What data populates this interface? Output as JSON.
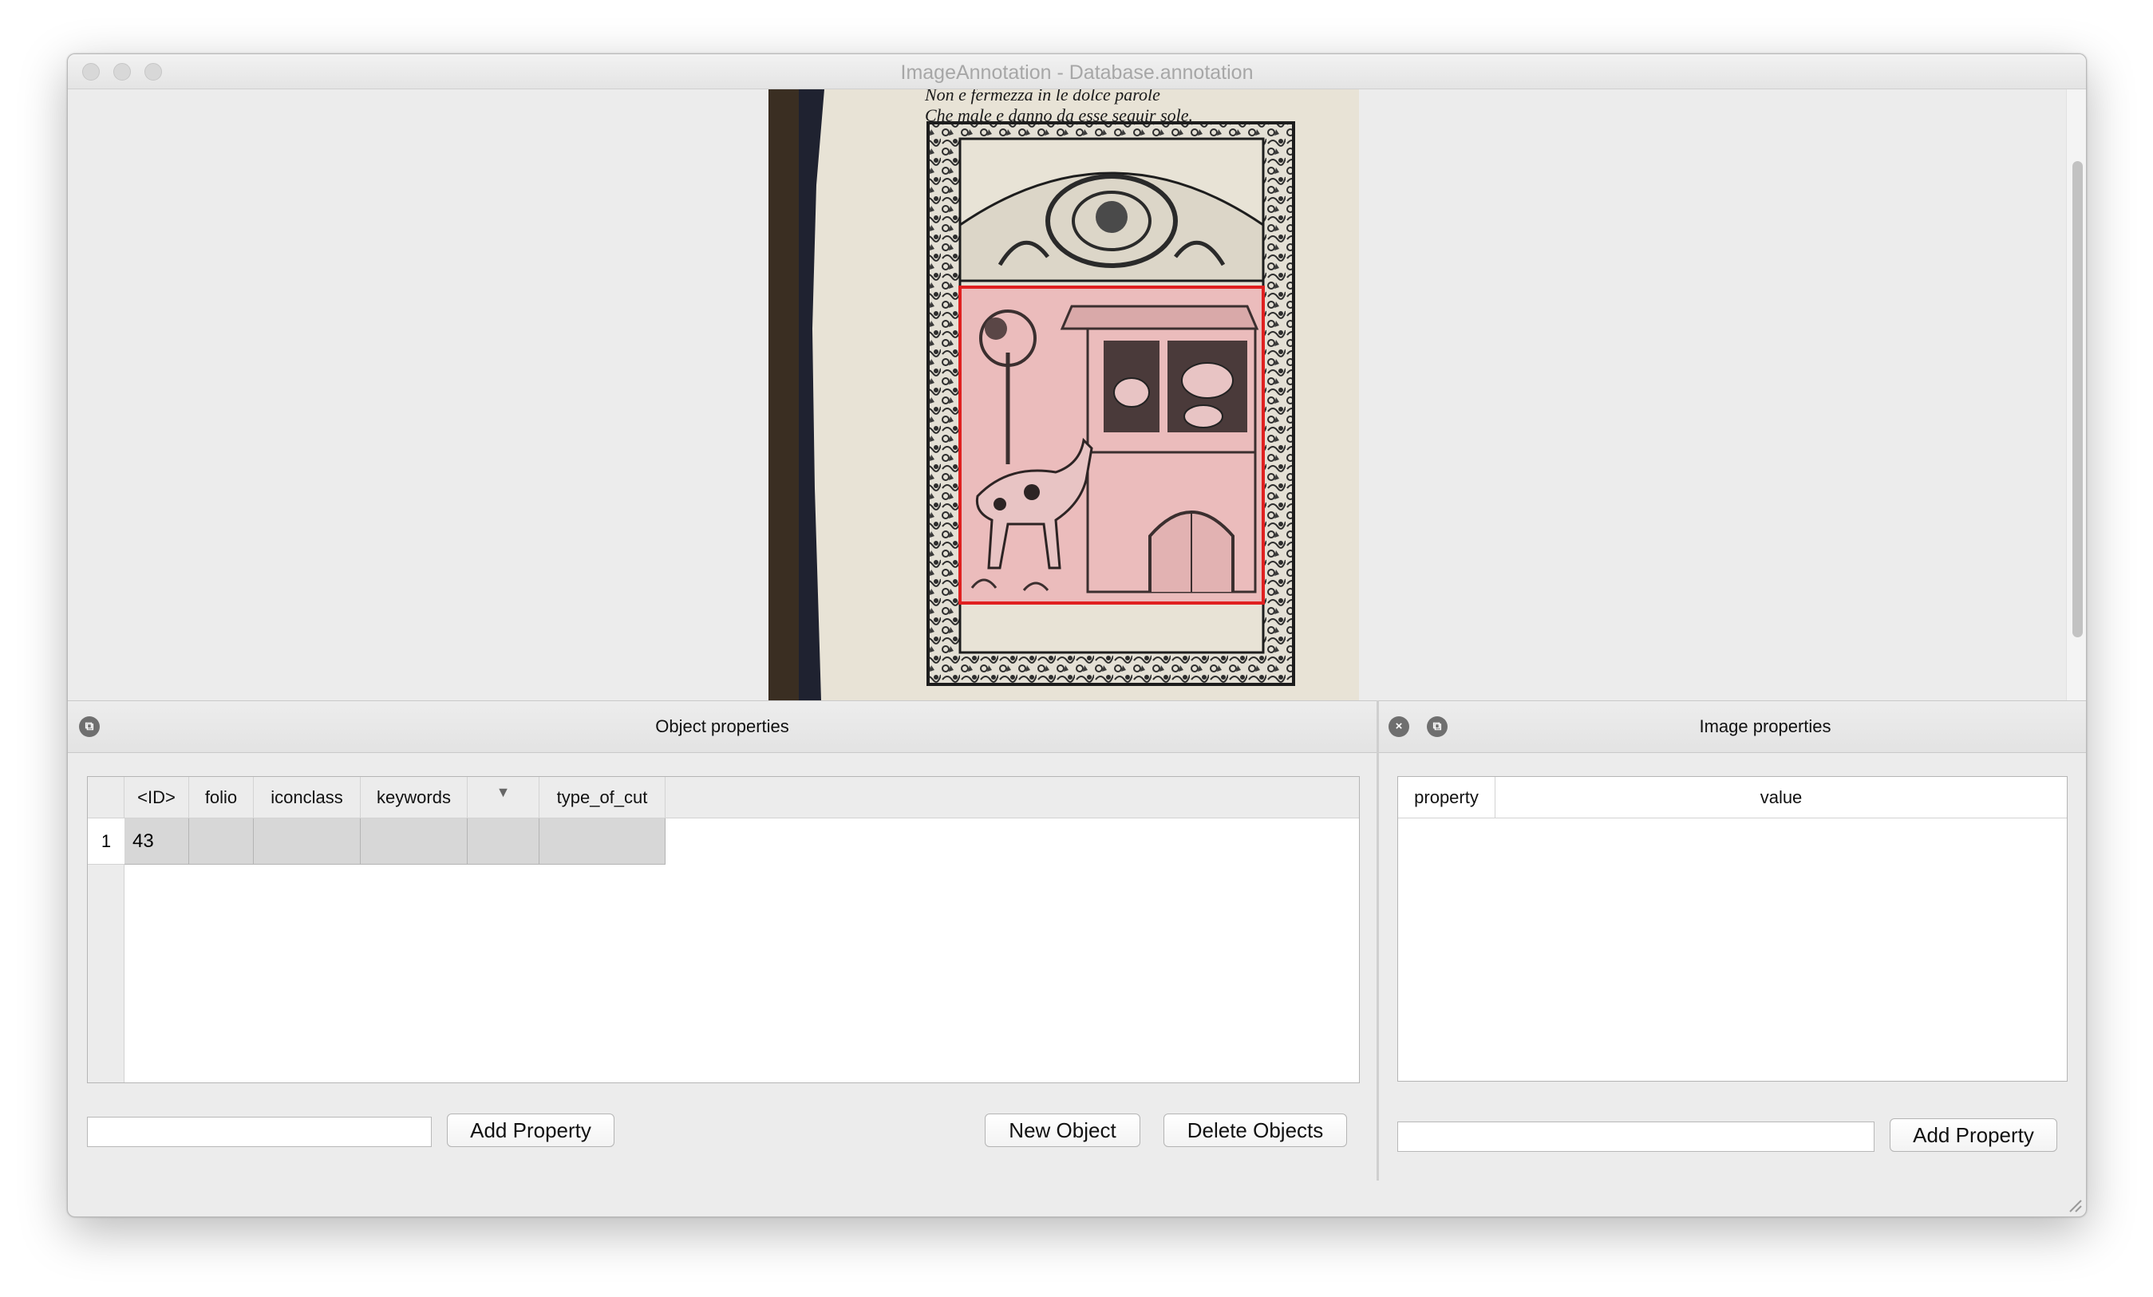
{
  "window": {
    "title": "ImageAnnotation - Database.annotation"
  },
  "image": {
    "caption_line1": "Non e fermezza in le dolce parole",
    "caption_line2": "Che male e danno da esse seguir sole."
  },
  "object_panel": {
    "title": "Object properties",
    "columns": [
      "<ID>",
      "folio",
      "iconclass",
      "keywords",
      "▼",
      "type_of_cut"
    ],
    "rows": [
      {
        "num": "1",
        "cells": [
          "43",
          "",
          "",
          "",
          "",
          ""
        ]
      }
    ],
    "property_input": {
      "value": "",
      "placeholder": ""
    },
    "add_property_label": "Add Property",
    "new_object_label": "New Object",
    "delete_objects_label": "Delete Objects"
  },
  "image_panel": {
    "title": "Image properties",
    "columns": [
      "property",
      "value"
    ],
    "property_input": {
      "value": "",
      "placeholder": ""
    },
    "add_property_label": "Add Property"
  },
  "colors": {
    "annotation_box": "#e02020",
    "annotation_fill": "#ebbcbc",
    "ink": "#2a2a2a",
    "paper": "#e8e3d6"
  }
}
